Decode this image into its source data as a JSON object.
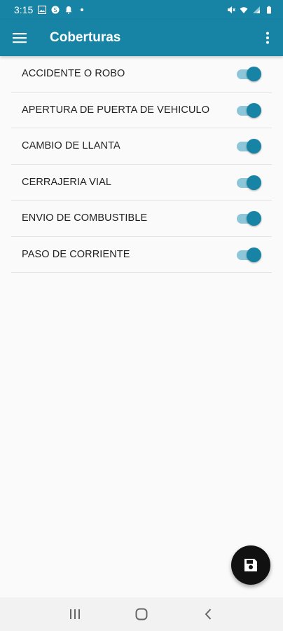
{
  "status_bar": {
    "time": "3:15",
    "icons": [
      "image-icon",
      "sync-icon",
      "bell-icon",
      "dot-icon",
      "mute-icon",
      "wifi-icon",
      "signal-icon",
      "battery-icon"
    ]
  },
  "app_bar": {
    "title": "Coberturas",
    "menu_icon": "hamburger-menu-icon",
    "overflow_icon": "more-vert-icon"
  },
  "coverages": [
    {
      "label": "ACCIDENTE O ROBO",
      "enabled": true
    },
    {
      "label": "APERTURA DE PUERTA DE VEHICULO",
      "enabled": true
    },
    {
      "label": "CAMBIO DE LLANTA",
      "enabled": true
    },
    {
      "label": "CERRAJERIA VIAL",
      "enabled": true
    },
    {
      "label": "ENVIO DE COMBUSTIBLE",
      "enabled": true
    },
    {
      "label": "PASO DE CORRIENTE",
      "enabled": true
    }
  ],
  "fab": {
    "icon": "save-icon"
  },
  "nav_bar": {
    "icons": [
      "recents-icon",
      "home-icon",
      "back-icon"
    ]
  },
  "colors": {
    "primary": "#1784a6",
    "switch_track": "#8cc6d8",
    "fab": "#111111",
    "background": "#fafafa"
  }
}
